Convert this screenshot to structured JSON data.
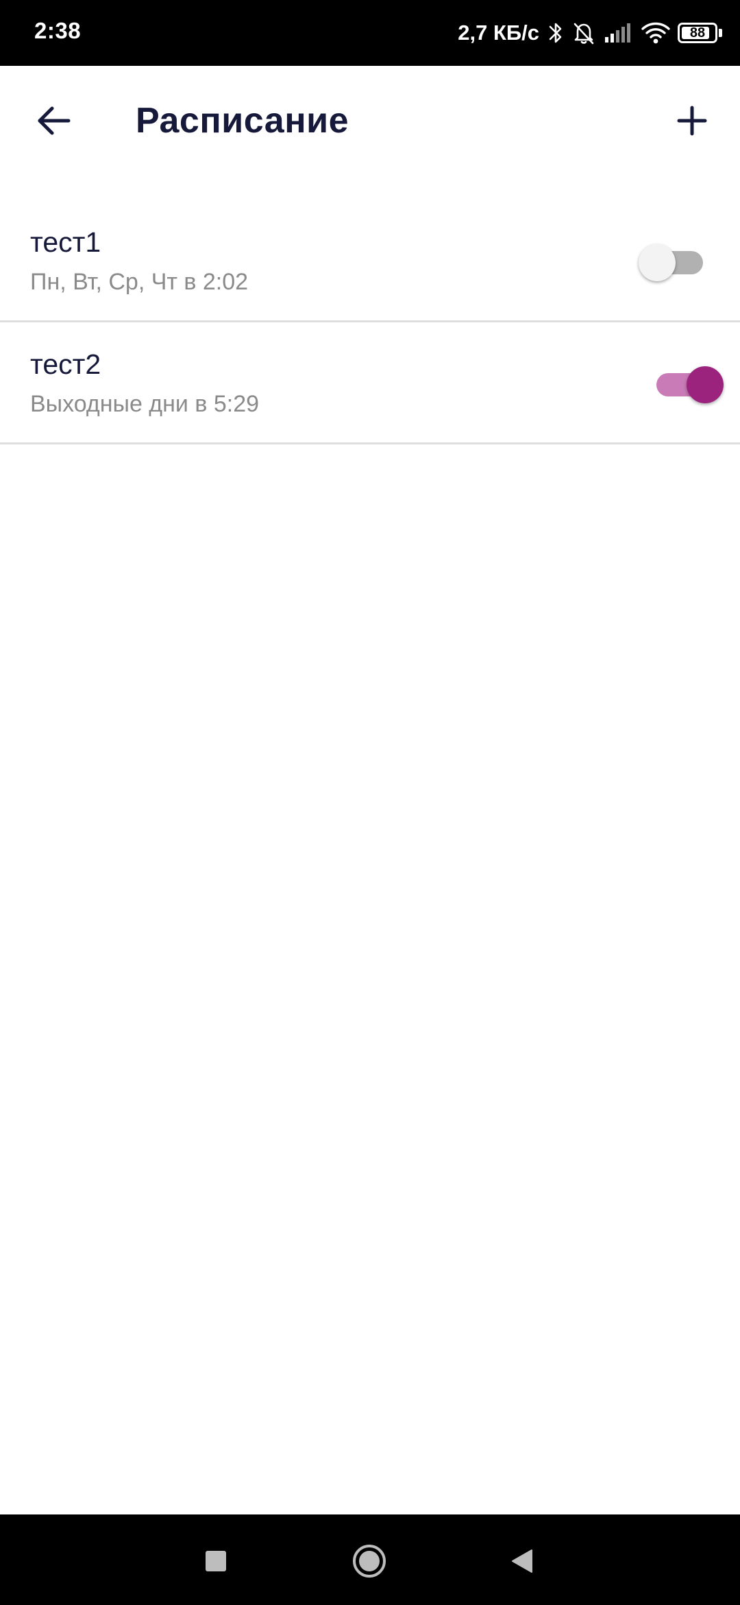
{
  "status_bar": {
    "time": "2:38",
    "net_speed": "2,7 КБ/с",
    "battery_level": "88",
    "icons": [
      "bluetooth-icon",
      "alarm-off-icon",
      "signal-icon",
      "wifi-icon",
      "battery-icon"
    ]
  },
  "app_bar": {
    "title": "Расписание",
    "back_icon": "arrow-left-icon",
    "add_icon": "plus-icon"
  },
  "schedules": [
    {
      "name": "тест1",
      "description": "Пн, Вт, Ср, Чт в 2:02",
      "enabled": false
    },
    {
      "name": "тест2",
      "description": "Выходные дни в 5:29",
      "enabled": true
    }
  ],
  "colors": {
    "title_text": "#17193a",
    "subtitle_text": "#8a8a8a",
    "switch_on_thumb": "#9b237e",
    "switch_on_track": "#c97bb7",
    "switch_off_thumb": "#f3f3f3",
    "switch_off_track": "#b1b1b1",
    "divider": "#dedede"
  },
  "nav_bar": {
    "items": [
      "recent-apps-icon",
      "home-icon",
      "back-triangle-icon"
    ]
  }
}
